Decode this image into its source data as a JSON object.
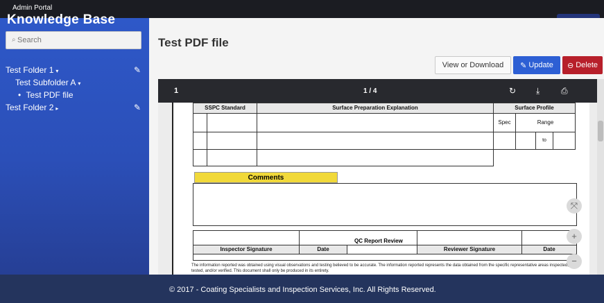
{
  "topbar": {
    "title": "Admin Portal"
  },
  "sidebar": {
    "heading": "Knowledge Base",
    "search": {
      "placeholder": "Search",
      "value": ""
    },
    "tree": [
      {
        "label": "Test Folder 1",
        "caret": "▾"
      },
      {
        "label": "Test Subfolder A",
        "caret": "▾"
      },
      {
        "label": "Test PDF file",
        "bullet": "•"
      },
      {
        "label": "Test Folder 2",
        "caret": "▸"
      }
    ]
  },
  "main": {
    "title": "Test PDF file",
    "buttons": {
      "view": "View or Download",
      "update": "Update",
      "delete": "Delete"
    }
  },
  "viewer": {
    "page": "1",
    "counter": "1 / 4",
    "icons": [
      "rotate-icon",
      "download-icon",
      "print-icon"
    ],
    "zoom": {
      "fit": "⤧",
      "in": "+",
      "out": "−"
    }
  },
  "pdf": {
    "table1": {
      "sspc_standard": "SSPC Standard",
      "surface_prep": "Surface Preparation Explanation",
      "surface_profile": "Surface Profile",
      "spec": "Spec",
      "range": "Range",
      "to": "to"
    },
    "comments": "Comments",
    "qc_report_review": "QC Report Review",
    "inspector_signature": "Inspector Signature",
    "date1": "Date",
    "reviewer_signature": "Reviewer Signature",
    "date2": "Date",
    "disclaimer": "The information reported was obtained using visual observations and testing believed to be accurate. The information reported represents the data obtained from the specific representative areas inspected, tested, and/or verified. This document shall only be produced in its entirety."
  },
  "footer": {
    "text": "© 2017 - Coating Specialists and Inspection Services, Inc. All Rights Reserved."
  },
  "colors": {
    "sidebar": "#2e58c8",
    "update": "#2d5fd4",
    "delete": "#b71f2a",
    "comments": "#f1d93a",
    "footer": "#24345d"
  }
}
